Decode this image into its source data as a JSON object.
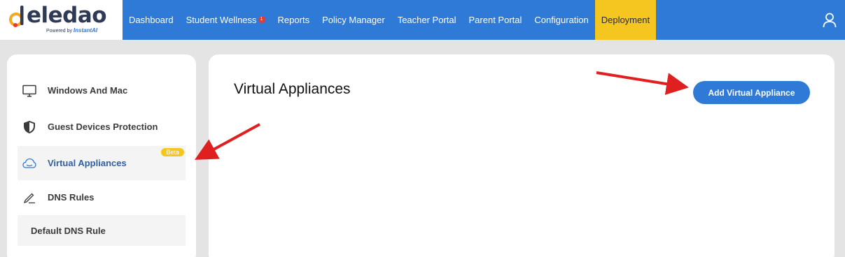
{
  "brand": {
    "name": "eledao",
    "powered_prefix": "Powered by",
    "powered_name": "InstantAI",
    "colors": {
      "primary": "#2f7ad6",
      "accent": "#f5c520",
      "badge": "#e53935"
    }
  },
  "nav": {
    "items": [
      {
        "label": "Dashboard"
      },
      {
        "label": "Student Wellness",
        "badge": "1"
      },
      {
        "label": "Reports"
      },
      {
        "label": "Policy Manager"
      },
      {
        "label": "Teacher Portal"
      },
      {
        "label": "Parent Portal"
      },
      {
        "label": "Configuration"
      },
      {
        "label": "Deployment",
        "active": true
      }
    ],
    "user_icon": "user-icon"
  },
  "sidebar": {
    "items": [
      {
        "label": "Windows And Mac",
        "icon": "monitor-icon"
      },
      {
        "label": "Guest Devices Protection",
        "icon": "shield-icon"
      },
      {
        "label": "Virtual Appliances",
        "icon": "cloud-icon",
        "badge": "Beta",
        "active": true
      },
      {
        "label": "DNS Rules",
        "icon": "pen-icon"
      }
    ],
    "sub_items": [
      {
        "label": "Default DNS Rule"
      }
    ]
  },
  "main": {
    "title": "Virtual Appliances",
    "add_button_label": "Add Virtual Appliance"
  }
}
